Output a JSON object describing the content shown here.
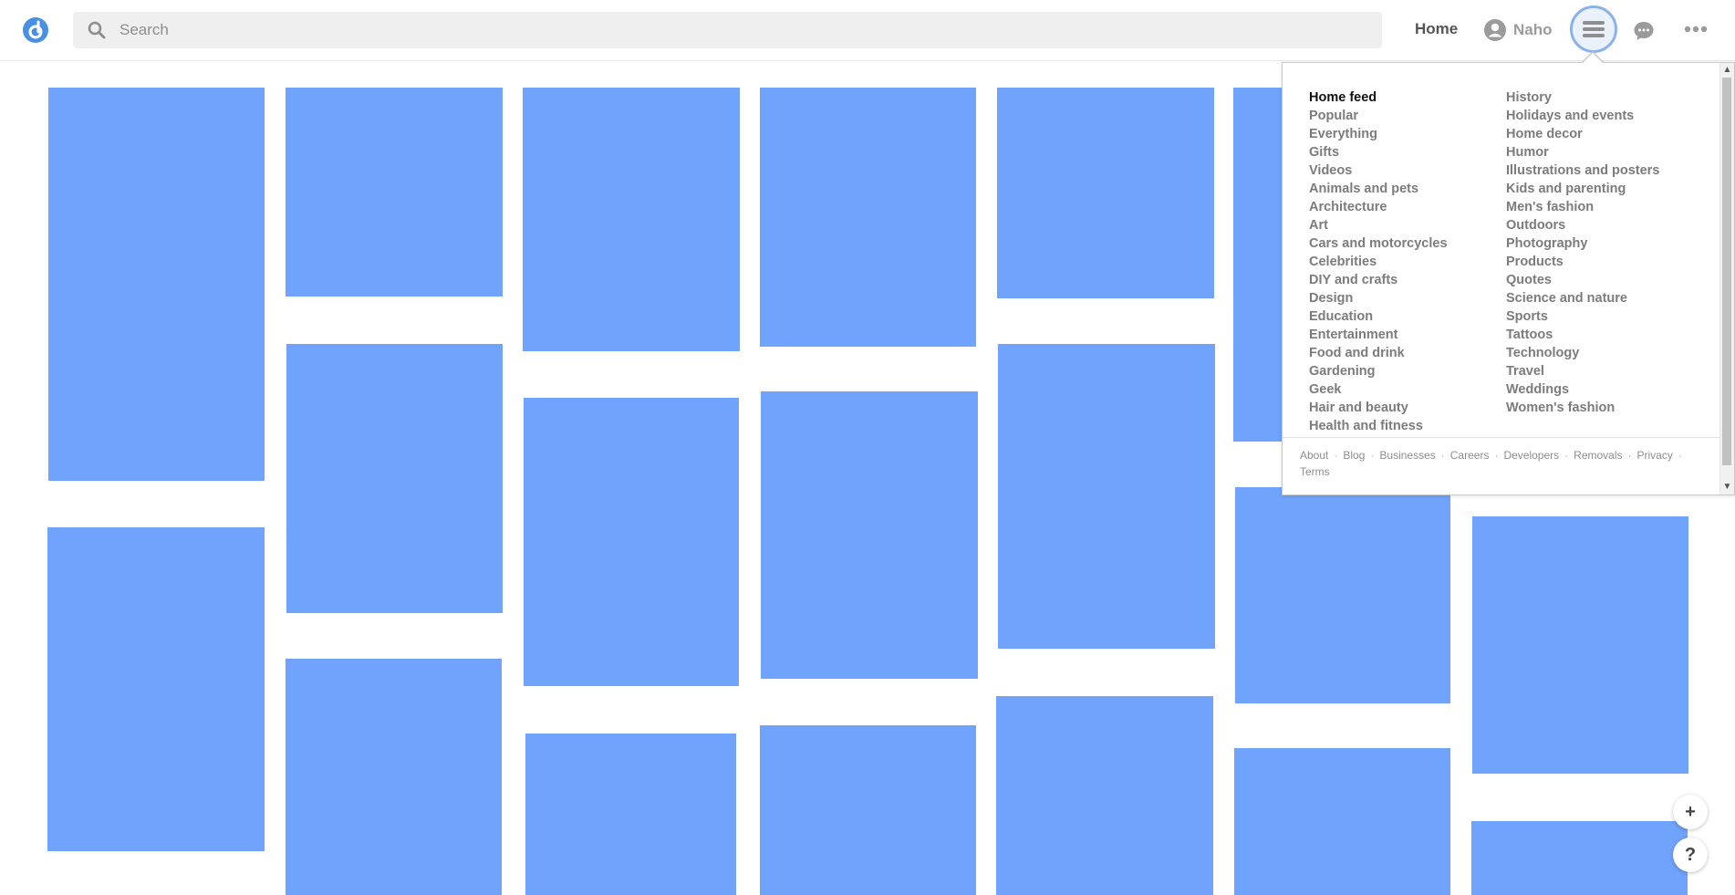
{
  "header": {
    "search_placeholder": "Search",
    "home_label": "Home",
    "user_name": "Naho"
  },
  "menu": {
    "left": [
      "Home feed",
      "Popular",
      "Everything",
      "Gifts",
      "Videos",
      "Animals and pets",
      "Architecture",
      "Art",
      "Cars and motorcycles",
      "Celebrities",
      "DIY and crafts",
      "Design",
      "Education",
      "Entertainment",
      "Food and drink",
      "Gardening",
      "Geek",
      "Hair and beauty",
      "Health and fitness"
    ],
    "right": [
      "History",
      "Holidays and events",
      "Home decor",
      "Humor",
      "Illustrations and posters",
      "Kids and parenting",
      "Men's fashion",
      "Outdoors",
      "Photography",
      "Products",
      "Quotes",
      "Science and nature",
      "Sports",
      "Tattoos",
      "Technology",
      "Travel",
      "Weddings",
      "Women's fashion"
    ],
    "active": "Home feed",
    "footer": [
      "About",
      "Blog",
      "Businesses",
      "Careers",
      "Developers",
      "Removals",
      "Privacy",
      "Terms"
    ]
  },
  "colors": {
    "accent": "#4a90e2",
    "tile": "#6fa3fc"
  },
  "fabs": {
    "add": "+",
    "help": "?"
  }
}
